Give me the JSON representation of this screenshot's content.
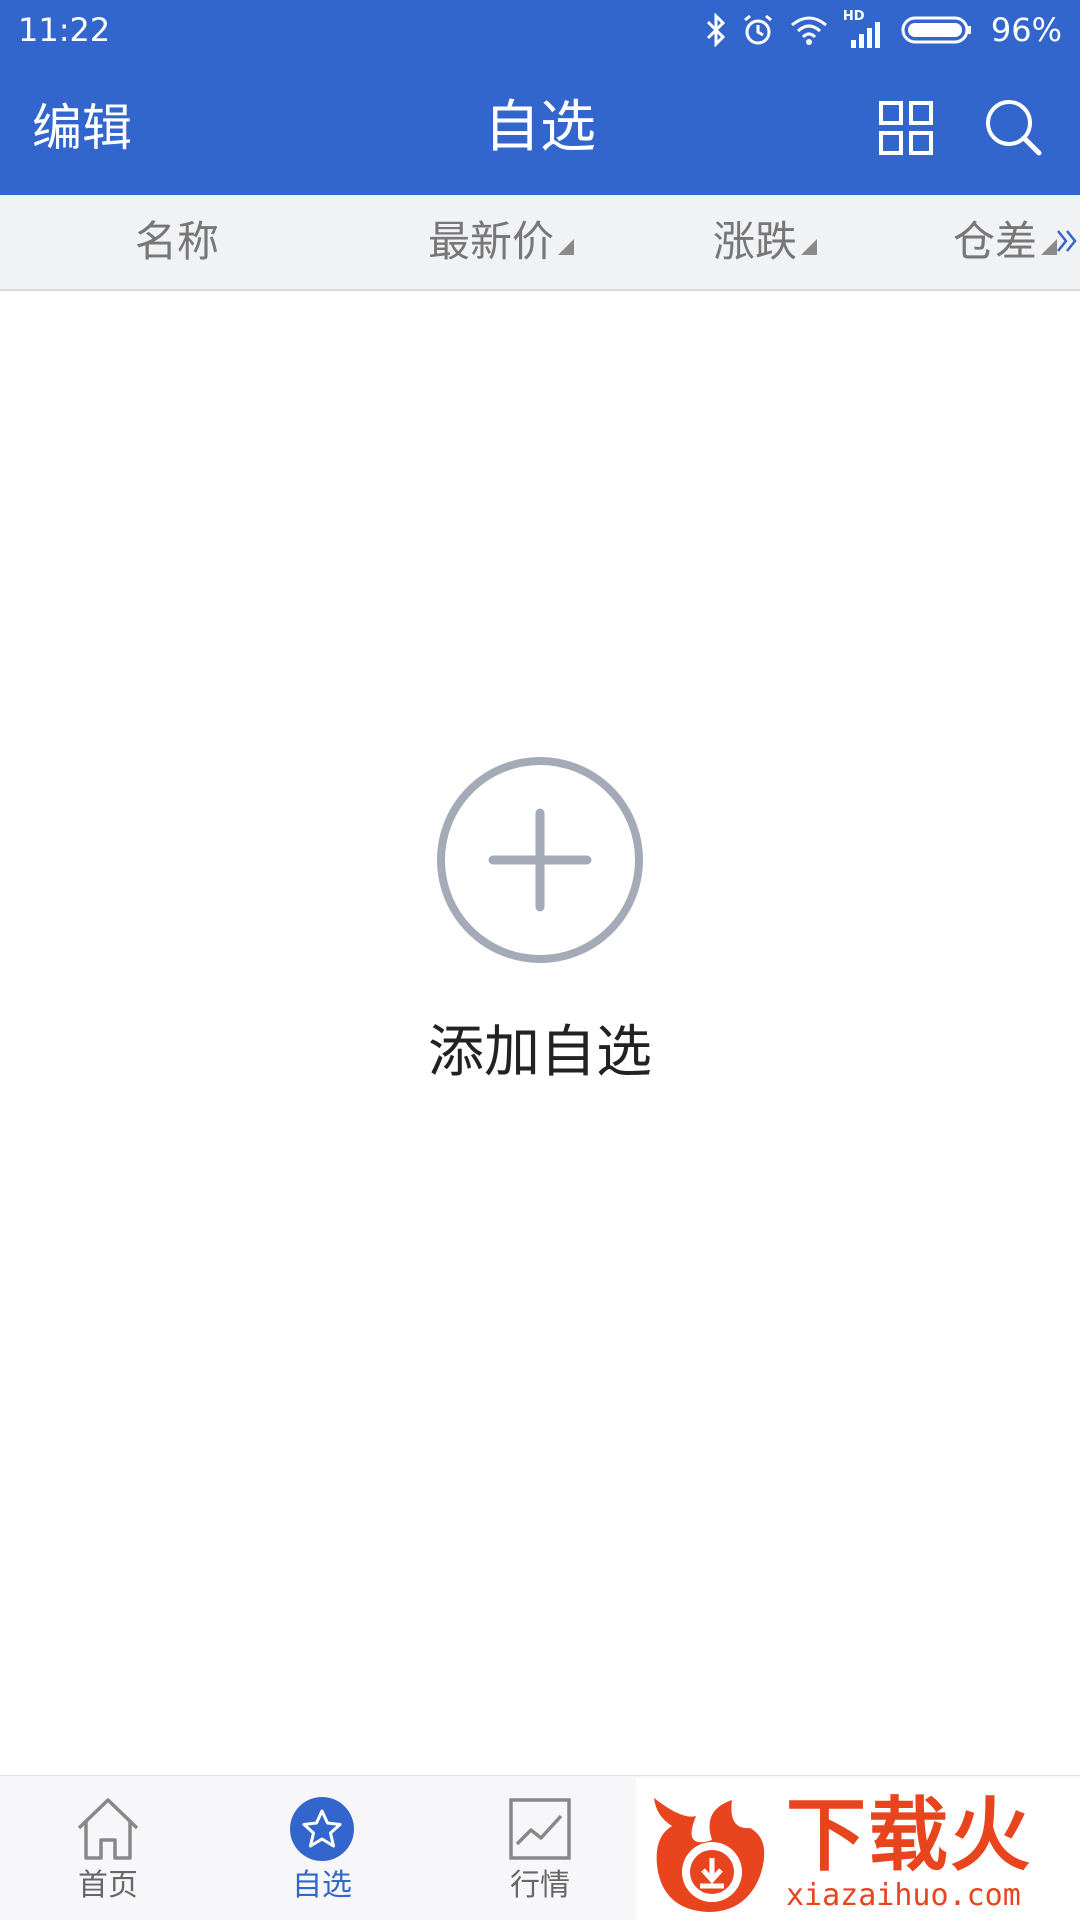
{
  "status_bar": {
    "time": "11:22",
    "network_badge": "HD",
    "battery_percent": "96%"
  },
  "nav": {
    "edit_label": "编辑",
    "title": "自选",
    "grid_icon": "grid-icon",
    "search_icon": "search-icon"
  },
  "columns": {
    "name": "名称",
    "price": "最新价",
    "change": "涨跌",
    "open_interest_change": "仓差",
    "more_icon": "double-chevron-right-icon"
  },
  "empty_state": {
    "icon": "plus-circle-icon",
    "label": "添加自选"
  },
  "tabs": [
    {
      "label": "首页",
      "icon": "home-icon",
      "active": false
    },
    {
      "label": "自选",
      "icon": "star-icon",
      "active": true
    },
    {
      "label": "行情",
      "icon": "line-chart-icon",
      "active": false
    }
  ],
  "watermark": {
    "text": "下载火",
    "url": "xiazaihuo.com"
  },
  "colors": {
    "primary": "#3366cc",
    "header_bg": "#f1f2f4",
    "empty_icon": "#a3abb6",
    "watermark": "#e8451f"
  }
}
